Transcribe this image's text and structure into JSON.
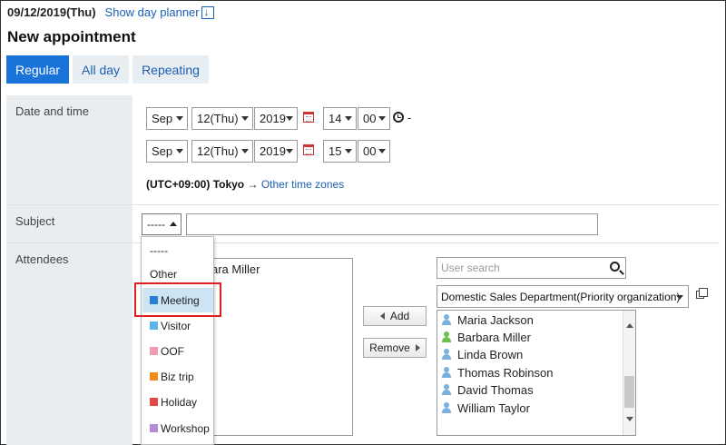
{
  "header": {
    "date": "09/12/2019(Thu)",
    "planner_link": "Show day planner",
    "title": "New appointment"
  },
  "tabs": [
    {
      "label": "Regular",
      "active": true
    },
    {
      "label": "All day",
      "active": false
    },
    {
      "label": "Repeating",
      "active": false
    }
  ],
  "form": {
    "date_time_label": "Date and time",
    "start": {
      "month": "Sep",
      "day": "12(Thu)",
      "year": "2019",
      "hour": "14",
      "minute": "00"
    },
    "end": {
      "month": "Sep",
      "day": "12(Thu)",
      "year": "2019",
      "hour": "15",
      "minute": "00"
    },
    "separator": "-",
    "timezone": "(UTC+09:00) Tokyo",
    "timezone_arrow": "→",
    "timezone_link": "Other time zones",
    "subject_label": "Subject",
    "subject_selected": "-----",
    "subject_value": "",
    "attendees_label": "Attendees",
    "attendee_partial": "ara Miller"
  },
  "subject_options": [
    {
      "label": "-----",
      "color": null,
      "highlighted": false
    },
    {
      "label": "Other",
      "color": null,
      "highlighted": false
    },
    {
      "label": "Meeting",
      "color": "#2a7fd4",
      "highlighted": true
    },
    {
      "label": "Visitor",
      "color": "#5bb5e8",
      "highlighted": false
    },
    {
      "label": "OOF",
      "color": "#f29ab0",
      "highlighted": false
    },
    {
      "label": "Biz trip",
      "color": "#f08a18",
      "highlighted": false
    },
    {
      "label": "Holiday",
      "color": "#e34848",
      "highlighted": false
    },
    {
      "label": "Workshop",
      "color": "#b48bd9",
      "highlighted": false
    }
  ],
  "buttons": {
    "add": "Add",
    "remove": "Remove"
  },
  "user_search": {
    "placeholder": "User search"
  },
  "department": "Domestic Sales Department(Priority organization)",
  "users": [
    {
      "name": "Maria Jackson",
      "color": "#7ab0e0"
    },
    {
      "name": "Barbara Miller",
      "color": "#6cc04a"
    },
    {
      "name": "Linda Brown",
      "color": "#7ab0e0"
    },
    {
      "name": "Thomas Robinson",
      "color": "#7ab0e0"
    },
    {
      "name": "David Thomas",
      "color": "#7ab0e0"
    },
    {
      "name": "William Taylor",
      "color": "#7ab0e0"
    }
  ]
}
